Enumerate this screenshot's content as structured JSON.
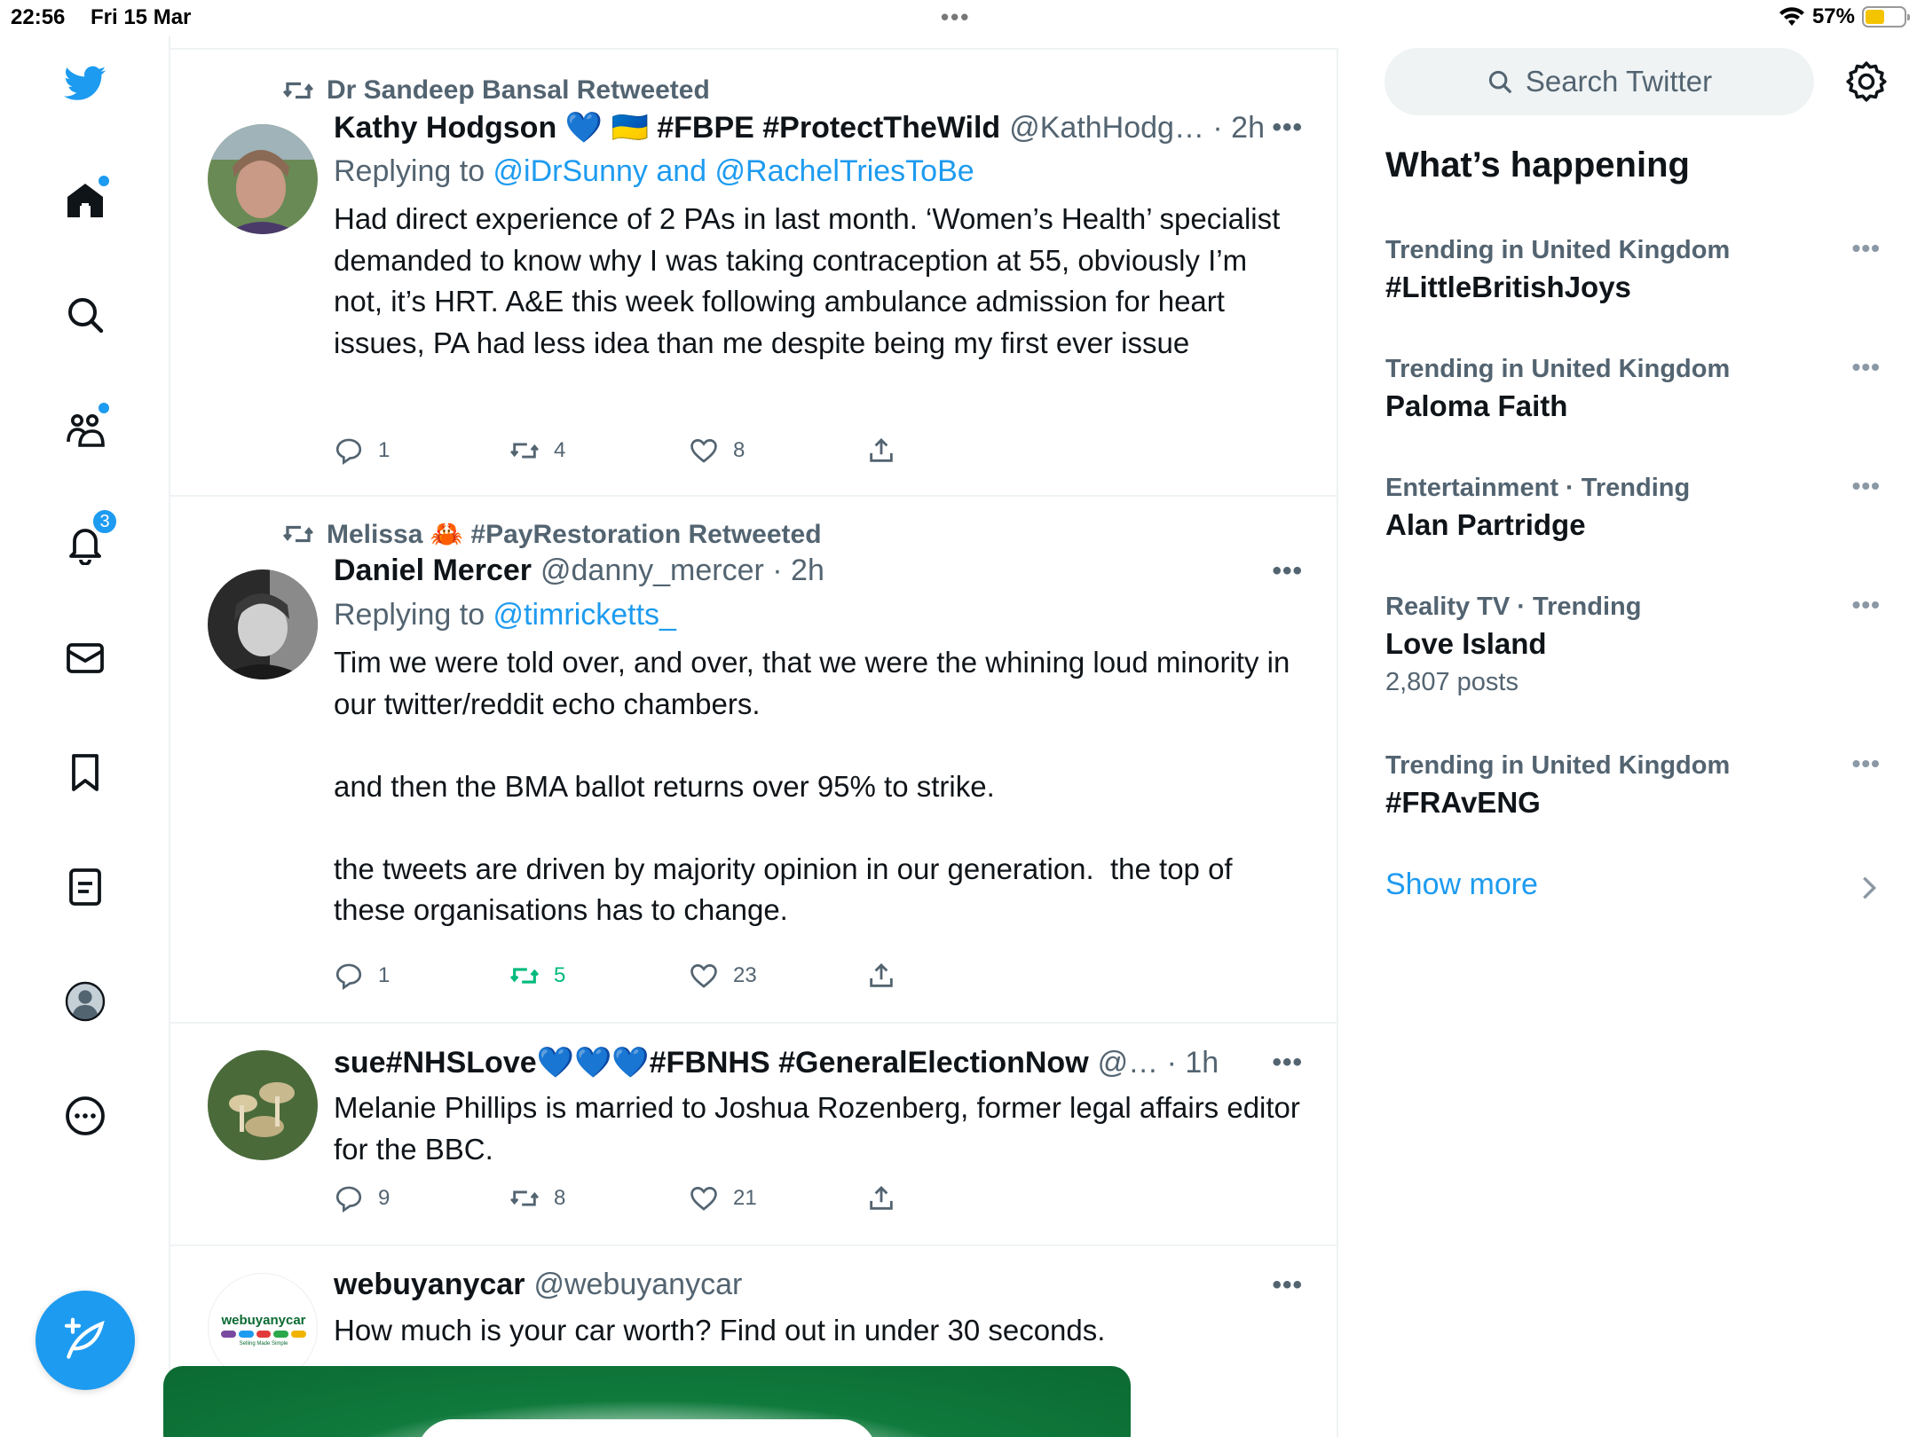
{
  "status_bar": {
    "time": "22:56",
    "date": "Fri 15 Mar",
    "battery": "57%",
    "battery_level": 0.57
  },
  "nav": {
    "notifications_badge": "3"
  },
  "search": {
    "placeholder": "Search Twitter"
  },
  "tweets": [
    {
      "retweeted_by": "Dr Sandeep Bansal Retweeted",
      "name": "Kathy Hodgson 💙 🇺🇦 #FBPE #ProtectTheWild",
      "handle": "@KathHodg… · 2h",
      "replying_prefix": "Replying to ",
      "replying_to": "@iDrSunny and @RachelTriesToBe",
      "text": "Had direct experience of 2 PAs in last month. ‘Women’s Health’ specialist demanded to know why I was taking contraception at 55, obviously I’m not, it’s HRT. A&E this week following ambulance admission for heart issues, PA had less idea than me despite being my first ever issue",
      "replies": "1",
      "retweets": "4",
      "likes": "8"
    },
    {
      "retweeted_by": "Melissa 🦀 #PayRestoration Retweeted",
      "name": "Daniel Mercer",
      "handle": "@danny_mercer · 2h",
      "replying_prefix": "Replying to ",
      "replying_to": "@timricketts_",
      "text": "Tim we were told over, and over, that we were the whining loud minority in our twitter/reddit echo chambers.\n\nand then the BMA ballot returns over 95% to strike.\n\nthe tweets are driven by majority opinion in our generation.  the top of these organisations has to change.",
      "replies": "1",
      "retweets": "5",
      "likes": "23"
    },
    {
      "name": "sue#NHSLove💙💙💙#FBNHS #GeneralElectionNow",
      "handle": "@… · 1h",
      "text": "Melanie Phillips is married to Joshua Rozenberg, former legal affairs editor for the BBC.",
      "replies": "9",
      "retweets": "8",
      "likes": "21"
    },
    {
      "name": "webuyanycar",
      "handle": "@webuyanycar",
      "text": "How much is your car worth? Find out in under 30 seconds.",
      "avatar_logo": "webuyanycar",
      "avatar_tagline": "Selling Made Simple"
    }
  ],
  "sidebar": {
    "title": "What’s happening",
    "trends": [
      {
        "context": "Trending in United Kingdom",
        "name": "#LittleBritishJoys",
        "posts": ""
      },
      {
        "context": "Trending in United Kingdom",
        "name": "Paloma Faith",
        "posts": ""
      },
      {
        "context": "Entertainment · Trending",
        "name": "Alan Partridge",
        "posts": ""
      },
      {
        "context": "Reality TV · Trending",
        "name": "Love Island",
        "posts": "2,807 posts"
      },
      {
        "context": "Trending in United Kingdom",
        "name": "#FRAvENG",
        "posts": ""
      }
    ],
    "show_more": "Show more"
  },
  "colors": {
    "accent": "#1d9bf0",
    "retweet_green": "#00ba7c",
    "muted": "#536471"
  }
}
